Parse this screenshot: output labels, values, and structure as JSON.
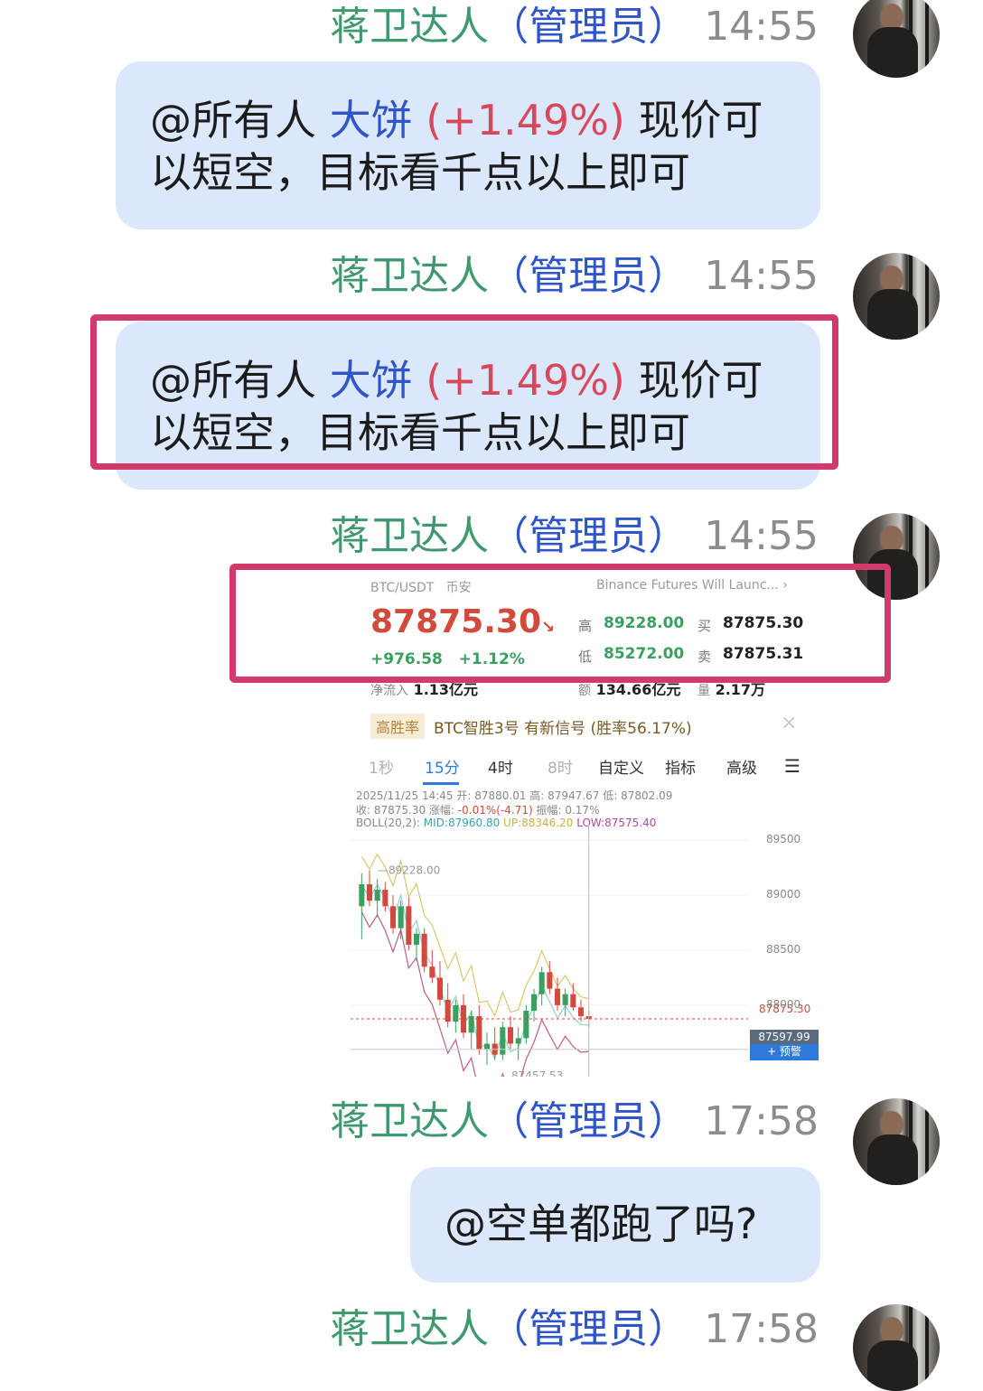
{
  "messages": [
    {
      "sender": "蒋卫达人",
      "role": "（管理员）",
      "time": "14:55",
      "mention": "@所有人",
      "coin": "大饼",
      "pct": "(+1.49%)",
      "text_a": "现价可",
      "text_b": "以短空，目标看千点以上即可"
    },
    {
      "sender": "蒋卫达人",
      "role": "（管理员）",
      "time": "14:55",
      "mention": "@所有人",
      "coin": "大饼",
      "pct": "(+1.49%)",
      "text_a": "现价可",
      "text_b": "以短空，目标看千点以上即可"
    },
    {
      "sender": "蒋卫达人",
      "role": "（管理员）",
      "time": "14:55"
    },
    {
      "sender": "蒋卫达人",
      "role": "（管理员）",
      "time": "17:58",
      "text": "@空单都跑了吗?"
    },
    {
      "sender": "蒋卫达人",
      "role": "（管理员）",
      "time": "17:58"
    }
  ],
  "quote": {
    "pair": "BTC/USDT",
    "exchange": "币安",
    "news": "Binance Futures Will Launc...",
    "news_arrow": "›",
    "price": "87875.30",
    "price_arrow": "↘",
    "change_abs": "+976.58",
    "change_pct": "+1.12%",
    "high_label": "高",
    "high": "89228.00",
    "low_label": "低",
    "low": "85272.00",
    "buy_label": "买",
    "buy": "87875.30",
    "sell_label": "卖",
    "sell": "87875.31",
    "net_inflow_label": "净流入",
    "net_inflow": "1.13亿元",
    "amount_label": "额",
    "amount": "134.66亿元",
    "volume_label": "量",
    "volume": "2.17万"
  },
  "signal": {
    "tag": "高胜率",
    "text": "BTC智胜3号 有新信号 (胜率56.17%)",
    "close": "×"
  },
  "timeframes": [
    "1秒",
    "15分",
    "4时",
    "8时",
    "自定义",
    "指标",
    "高级"
  ],
  "ohlc": {
    "line1": "2025/11/25 14:45 开: 87880.01 高: 87947.67 低: 87802.09",
    "line2_a": "收: 87875.30 涨幅: ",
    "line2_b": "-0.01%(-4.71)",
    "line2_c": " 振幅: 0.17%",
    "boll": "BOLL(20,2): ",
    "mid": "MID:87960.80",
    "up": "UP:88346.20",
    "low": "LOW:87575.40"
  },
  "chart_data": {
    "type": "candlestick",
    "y_ticks": [
      89500,
      89000,
      88500,
      88000
    ],
    "ylim": [
      87350,
      89650
    ],
    "high_marker": "89228.00",
    "low_marker": "87457.53",
    "last_price": "87875.30",
    "alert_price": "87597.99",
    "alert_label": "+ 预警",
    "candles": [
      [
        88900,
        89200,
        88600,
        89100
      ],
      [
        89100,
        89228,
        88900,
        88950
      ],
      [
        88950,
        89150,
        88800,
        89050
      ],
      [
        89050,
        89120,
        88850,
        88900
      ],
      [
        88900,
        89000,
        88650,
        88700
      ],
      [
        88700,
        88950,
        88600,
        88900
      ],
      [
        88900,
        88980,
        88500,
        88550
      ],
      [
        88550,
        88700,
        88400,
        88650
      ],
      [
        88650,
        88700,
        88300,
        88350
      ],
      [
        88350,
        88500,
        88200,
        88250
      ],
      [
        88250,
        88400,
        88000,
        88050
      ],
      [
        88050,
        88200,
        87800,
        87850
      ],
      [
        87850,
        88050,
        87750,
        88000
      ],
      [
        88000,
        88100,
        87700,
        87750
      ],
      [
        87750,
        87950,
        87600,
        87900
      ],
      [
        87900,
        88000,
        87550,
        87600
      ],
      [
        87600,
        87750,
        87457,
        87650
      ],
      [
        87650,
        87800,
        87500,
        87550
      ],
      [
        87550,
        87850,
        87500,
        87800
      ],
      [
        87800,
        87900,
        87600,
        87650
      ],
      [
        87650,
        87800,
        87500,
        87700
      ],
      [
        87700,
        88000,
        87650,
        87950
      ],
      [
        87950,
        88150,
        87850,
        88100
      ],
      [
        88100,
        88350,
        88000,
        88300
      ],
      [
        88300,
        88400,
        88100,
        88150
      ],
      [
        88150,
        88250,
        87950,
        88000
      ],
      [
        88000,
        88150,
        87900,
        88100
      ],
      [
        88100,
        88200,
        87950,
        87980
      ],
      [
        87980,
        88050,
        87850,
        87900
      ],
      [
        87900,
        87950,
        87802,
        87875
      ]
    ]
  }
}
